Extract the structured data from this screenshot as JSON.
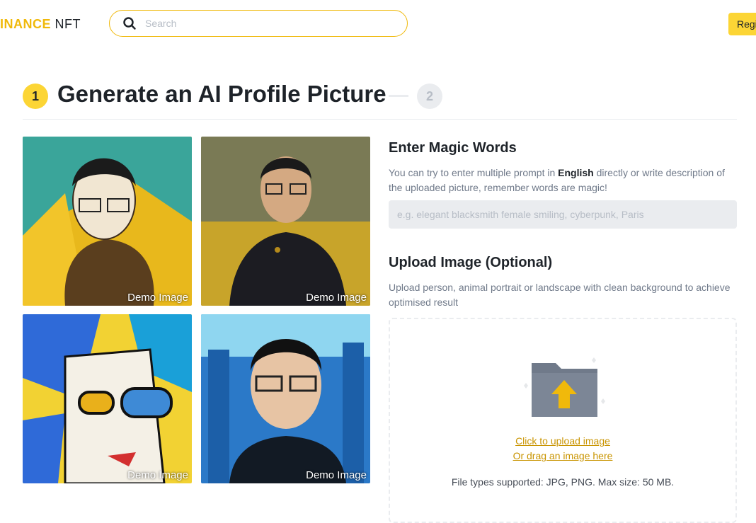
{
  "header": {
    "logo_brand": "INANCE",
    "logo_nft": "NFT",
    "search_placeholder": "Search",
    "register_label": "Regi"
  },
  "steps": {
    "step1": "1",
    "title": "Generate an AI Profile Picture",
    "step2": "2"
  },
  "demo_images": [
    {
      "label": "Demo Image"
    },
    {
      "label": "Demo Image"
    },
    {
      "label": "Demo Image"
    },
    {
      "label": "Demo Image"
    }
  ],
  "magic": {
    "title": "Enter Magic Words",
    "desc_before": "You can try to enter multiple prompt in ",
    "desc_bold": "English",
    "desc_after": " directly or write description of the uploaded picture, remember words are magic!",
    "placeholder": "e.g. elegant blacksmith female smiling, cyberpunk, Paris"
  },
  "upload": {
    "title": "Upload Image (Optional)",
    "desc": "Upload person, animal portrait or landscape with clean background to achieve optimised result",
    "click_label": "Click to upload image",
    "drag_label": "Or drag an image here",
    "file_types": "File types supported: JPG, PNG. Max size: 50 MB."
  },
  "colors": {
    "accent": "#fcd535",
    "brand_text": "#f0b90b",
    "link": "#c99400"
  }
}
